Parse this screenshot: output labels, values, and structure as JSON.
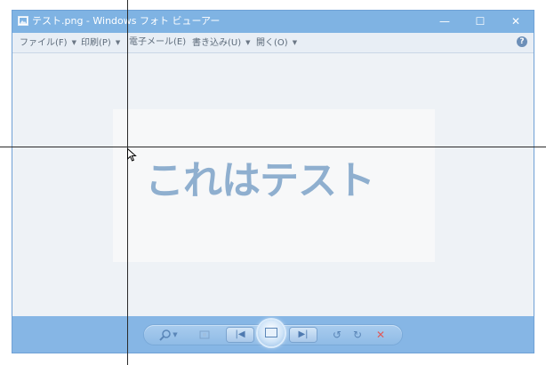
{
  "window": {
    "title": "テスト.png - Windows フォト ビューアー",
    "controls": {
      "minimize": "—",
      "maximize": "☐",
      "close": "✕"
    }
  },
  "menu": {
    "items": [
      {
        "label": "ファイル(F)",
        "has_caret": true
      },
      {
        "label": "印刷(P)",
        "has_caret": true
      },
      {
        "label": "電子メール(E)",
        "has_caret": false
      },
      {
        "label": "書き込み(U)",
        "has_caret": true
      },
      {
        "label": "開く(O)",
        "has_caret": true
      }
    ],
    "caret": "▼",
    "help": "?"
  },
  "image": {
    "text": "これはテスト"
  },
  "toolbar": {
    "zoom_icon": "search-icon",
    "fit_icon": "fit-to-window-icon",
    "prev_glyph": "|◀",
    "next_glyph": "▶|",
    "rotate_ccw_glyph": "↺",
    "rotate_cw_glyph": "↻",
    "delete_glyph": "✕"
  },
  "colors": {
    "titlebar": "#7fb3e3",
    "toolbar": "#86b6e5",
    "image_text": "#8fafcf",
    "delete": "#e05a5a"
  }
}
